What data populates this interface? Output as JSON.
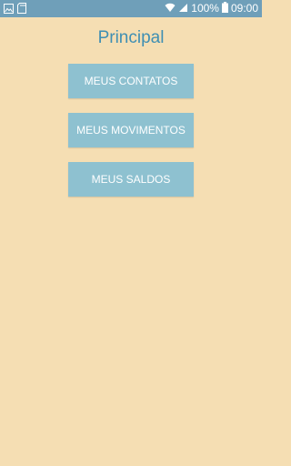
{
  "status_bar": {
    "battery": "100%",
    "time": "09:00"
  },
  "page": {
    "title": "Principal"
  },
  "menu": {
    "items": [
      {
        "label": "MEUS CONTATOS"
      },
      {
        "label": "MEUS MOVIMENTOS"
      },
      {
        "label": "MEUS SALDOS"
      }
    ]
  },
  "colors": {
    "background": "#f5deb3",
    "status_bar": "#6f9fb9",
    "title": "#3f8fb3",
    "button": "#8ec1d0",
    "button_text": "#ffffff"
  },
  "icons": [
    "gallery-icon",
    "sd-card-icon",
    "wifi-icon",
    "signal-icon",
    "battery-icon"
  ]
}
